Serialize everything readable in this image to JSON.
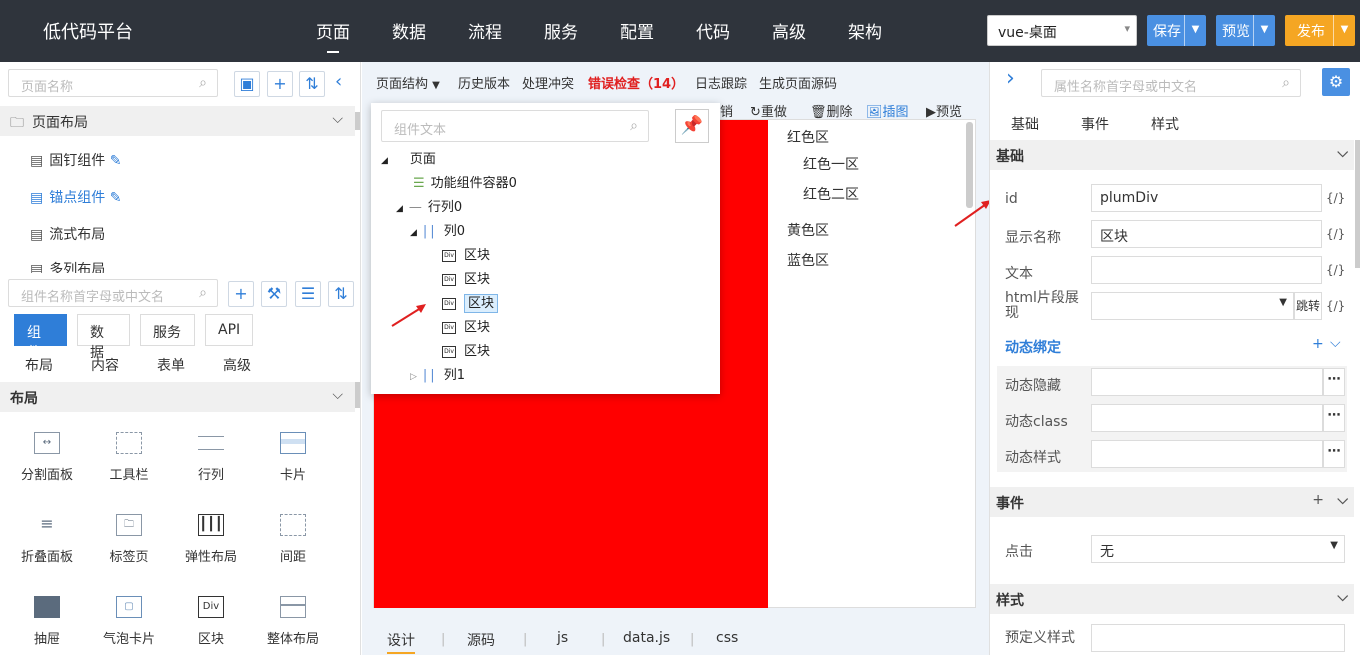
{
  "app_title": "低代码平台",
  "nav": [
    "页面",
    "数据",
    "流程",
    "服务",
    "配置",
    "代码",
    "高级",
    "架构"
  ],
  "env_select": "vue-桌面",
  "buttons": {
    "save": "保存",
    "preview": "预览",
    "publish": "发布"
  },
  "left": {
    "page_search_placeholder": "页面名称",
    "page_layout_section": "页面布局",
    "pages": [
      "固钉组件",
      "锚点组件",
      "流式布局",
      "多列布局"
    ],
    "comp_search_placeholder": "组件名称首字母或中文名",
    "tabs": [
      "组件",
      "数据",
      "服务",
      "API"
    ],
    "subtabs": [
      "布局",
      "内容",
      "表单",
      "高级"
    ],
    "layout_section": "布局",
    "components": [
      "分割面板",
      "工具栏",
      "行列",
      "卡片",
      "折叠面板",
      "标签页",
      "弹性布局",
      "间距",
      "抽屉",
      "气泡卡片",
      "区块",
      "整体布局"
    ]
  },
  "toolbar": {
    "structure": "页面结构",
    "history": "历史版本",
    "conflict": "处理冲突",
    "errors": "错误检查（14）",
    "log": "日志跟踪",
    "gen_source": "生成页面源码",
    "undo": "销",
    "redo": "重做",
    "delete": "删除",
    "insert": "插图",
    "preview": "预览"
  },
  "popup": {
    "search_placeholder": "组件文本",
    "nodes": [
      "页面",
      "功能组件容器0",
      "行列0",
      "列0",
      "区块",
      "区块",
      "区块",
      "区块",
      "区块",
      "列1"
    ]
  },
  "canvas_text": [
    "红色区",
    "红色一区",
    "红色二区",
    "黄色区",
    "蓝色区"
  ],
  "bottom_tabs": [
    "设计",
    "源码",
    "js",
    "data.js",
    "css"
  ],
  "right": {
    "search_placeholder": "属性名称首字母或中文名",
    "tabs": [
      "基础",
      "事件",
      "样式"
    ],
    "basic_section": "基础",
    "id_label": "id",
    "id_value": "plumDiv",
    "display_label": "显示名称",
    "display_value": "区块",
    "text_label": "文本",
    "html_label": "html片段展现",
    "jump": "跳转",
    "expr": "{/}",
    "dyn_binding": "动态绑定",
    "dyn_hide": "动态隐藏",
    "dyn_class": "动态class",
    "dyn_style": "动态样式",
    "event_section": "事件",
    "click_label": "点击",
    "click_value": "无",
    "style_section": "样式",
    "predef_style": "预定义样式"
  },
  "colors": {
    "topbar": "#2f343c",
    "save": "#4a90e2",
    "preview": "#4a90e2",
    "publish": "#f5a623",
    "accent": "#2f7ed8",
    "error": "#e02020"
  }
}
